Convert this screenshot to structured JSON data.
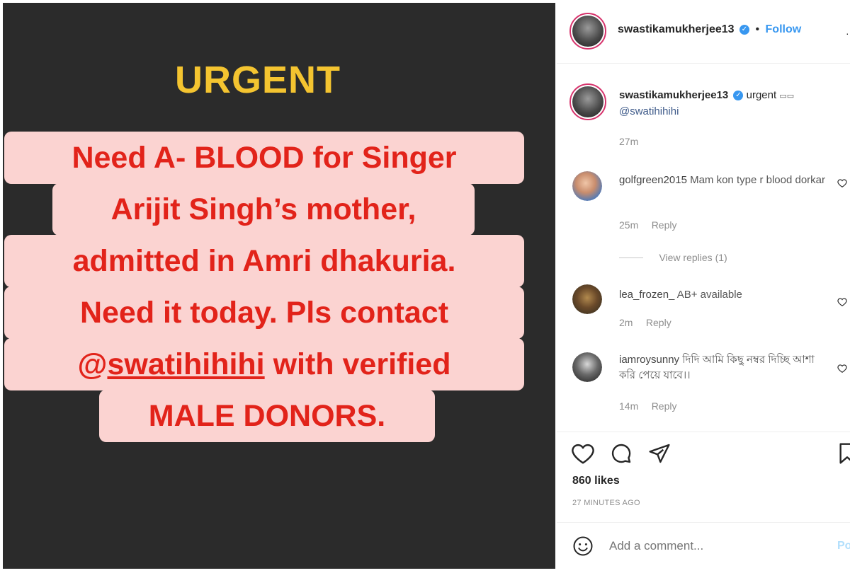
{
  "story": {
    "heading": "URGENT",
    "lines": [
      {
        "pre": "Need A- BLOOD for Singer",
        "mention": "",
        "post": ""
      },
      {
        "pre": "Arijit Singh’s mother,",
        "mention": "",
        "post": ""
      },
      {
        "pre": "admitted in Amri dhakuria.",
        "mention": "",
        "post": ""
      },
      {
        "pre": "Need it today. Pls contact",
        "mention": "",
        "post": ""
      },
      {
        "pre": "@",
        "mention": "swatihihihi",
        "post": " with verified"
      },
      {
        "pre": "MALE DONORS.",
        "mention": "",
        "post": ""
      }
    ],
    "colors": {
      "background": "#2b2b2b",
      "heading": "#f4c430",
      "text": "#e2231a",
      "highlight": "#fbd3d1"
    }
  },
  "header": {
    "username": "swastikamukherjee13",
    "verified_icon": "verified-badge-icon",
    "separator": "•",
    "follow_label": "Follow"
  },
  "caption": {
    "username": "swastikamukherjee13",
    "text": "urgent",
    "emoji_placeholder": "▭▭",
    "mention": "@swatihihihi",
    "time": "27m"
  },
  "comments": [
    {
      "username": "golfgreen2015",
      "text": "Mam kon type r blood dorkar",
      "time": "25m",
      "reply": "Reply",
      "view_replies": "View replies (1)"
    },
    {
      "username": "lea_frozen_",
      "text": "AB+ available",
      "time": "2m",
      "reply": "Reply"
    },
    {
      "username": "iamroysunny",
      "text": "দিদি আমি কিছু নম্বর দিচ্ছি আশা করি পেয়ে যাবে।।",
      "time": "14m",
      "reply": "Reply"
    }
  ],
  "actions": {
    "likes": "860 likes",
    "timestamp": "27 MINUTES AGO"
  },
  "add_comment": {
    "placeholder": "Add a comment...",
    "post_label": "Po"
  },
  "colors": {
    "accent": "#3897f0",
    "muted": "#8e8e8e"
  }
}
